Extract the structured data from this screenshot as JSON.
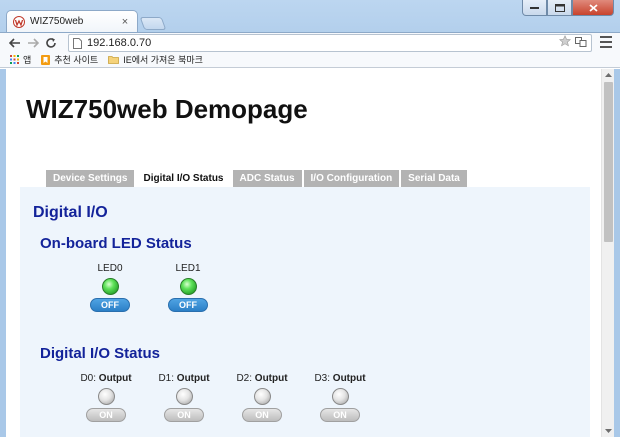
{
  "browser": {
    "tab_title": "WIZ750web",
    "tab_close": "×",
    "url": "192.168.0.70",
    "bookmarks": [
      {
        "label": "앱",
        "icon": "apps-grid-icon"
      },
      {
        "label": "추천 사이트",
        "icon": "bookmark-page-icon"
      },
      {
        "label": "IE에서 가져온 북마크",
        "icon": "folder-icon"
      }
    ]
  },
  "page": {
    "title": "WIZ750web Demopage",
    "tabs": [
      "Device Settings",
      "Digital I/O Status",
      "ADC Status",
      "I/O Configuration",
      "Serial Data"
    ],
    "active_tab": "Digital I/O Status",
    "section_title": "Digital I/O",
    "led_section_title": "On-board LED Status",
    "leds": [
      {
        "label": "LED0",
        "state": "OFF",
        "lamp_color": "green"
      },
      {
        "label": "LED1",
        "state": "OFF",
        "lamp_color": "green"
      }
    ],
    "dio_section_title": "Digital I/O Status",
    "dio": [
      {
        "name": "D0:",
        "mode": "Output",
        "state": "ON"
      },
      {
        "name": "D1:",
        "mode": "Output",
        "state": "ON"
      },
      {
        "name": "D2:",
        "mode": "Output",
        "state": "ON"
      },
      {
        "name": "D3:",
        "mode": "Output",
        "state": "ON"
      }
    ]
  },
  "colors": {
    "heading": "#13239a",
    "panel_bg": "#eef5fc",
    "tab_inactive": "#b3b3b3",
    "button_blue": "#2b7fc7"
  }
}
